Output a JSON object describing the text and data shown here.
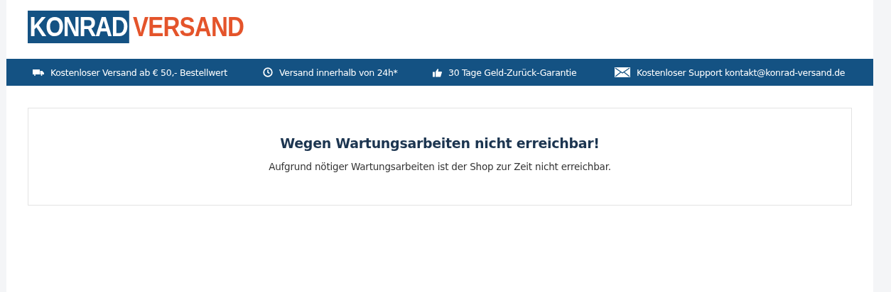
{
  "logo": {
    "part_1": "KONRAD",
    "part_2": "VERSAND"
  },
  "benefits": [
    {
      "kind": "truck",
      "text": "Kostenloser Versand ab € 50,- Bestellwert"
    },
    {
      "kind": "clock",
      "text": "Versand innerhalb von 24h*"
    },
    {
      "kind": "thumb",
      "text": "30 Tage Geld-Zurück-Garantie"
    },
    {
      "kind": "mail",
      "text": "Kostenloser Support kontakt@konrad-versand.de"
    }
  ],
  "notice": {
    "title": "Wegen Wartungsarbeiten nicht erreichbar!",
    "message": "Aufgrund nötiger Wartungsarbeiten ist der Shop zur Zeit nicht erreichbar."
  }
}
